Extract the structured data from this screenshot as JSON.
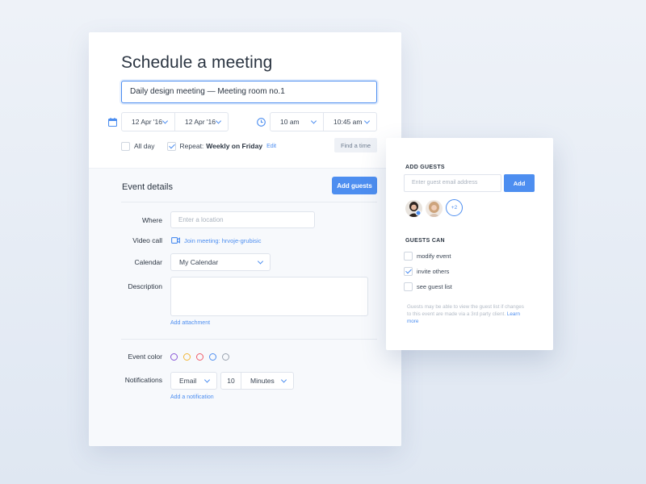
{
  "form": {
    "title": "Schedule a meeting",
    "event_title_value": "Daily design meeting — Meeting room no.1",
    "start_date": "12 Apr '16",
    "end_date": "12 Apr '16",
    "start_time": "10 am",
    "end_time": "10:45 am",
    "all_day_label": "All day",
    "all_day_checked": false,
    "repeat_label": "Repeat:",
    "repeat_value": "Weekly on Friday",
    "repeat_checked": true,
    "edit_label": "Edit",
    "find_time_label": "Find a time"
  },
  "details": {
    "section_title": "Event details",
    "add_guests_label": "Add guests",
    "where_label": "Where",
    "where_placeholder": "Enter a location",
    "video_label": "Video call",
    "video_link": "Join meeting: hrvoje-grubisic",
    "calendar_label": "Calendar",
    "calendar_value": "My Calendar",
    "description_label": "Description",
    "add_attachment": "Add attachment",
    "event_color_label": "Event color",
    "event_colors": [
      "#8a56d6",
      "#f2b736",
      "#ef5d6b",
      "#4d8ef0",
      "#9aa3af"
    ],
    "notifications_label": "Notifications",
    "notification_type": "Email",
    "notification_amount": "10",
    "notification_unit": "Minutes",
    "add_notification": "Add a notification"
  },
  "guests": {
    "heading": "ADD GUESTS",
    "email_placeholder": "Enter guest email address",
    "add_label": "Add",
    "more_count": "+2",
    "permissions_heading": "GUESTS CAN",
    "permissions": [
      {
        "label": "modify event",
        "checked": false
      },
      {
        "label": "invite others",
        "checked": true
      },
      {
        "label": "see guest list",
        "checked": false
      }
    ],
    "note": "Guests may be able to view the guest list if changes to this event are made via a 3rd party client.",
    "learn_more": "Learn more"
  },
  "colors": {
    "accent": "#4d8ef0",
    "text": "#2b3542",
    "muted": "#aab3bf"
  }
}
